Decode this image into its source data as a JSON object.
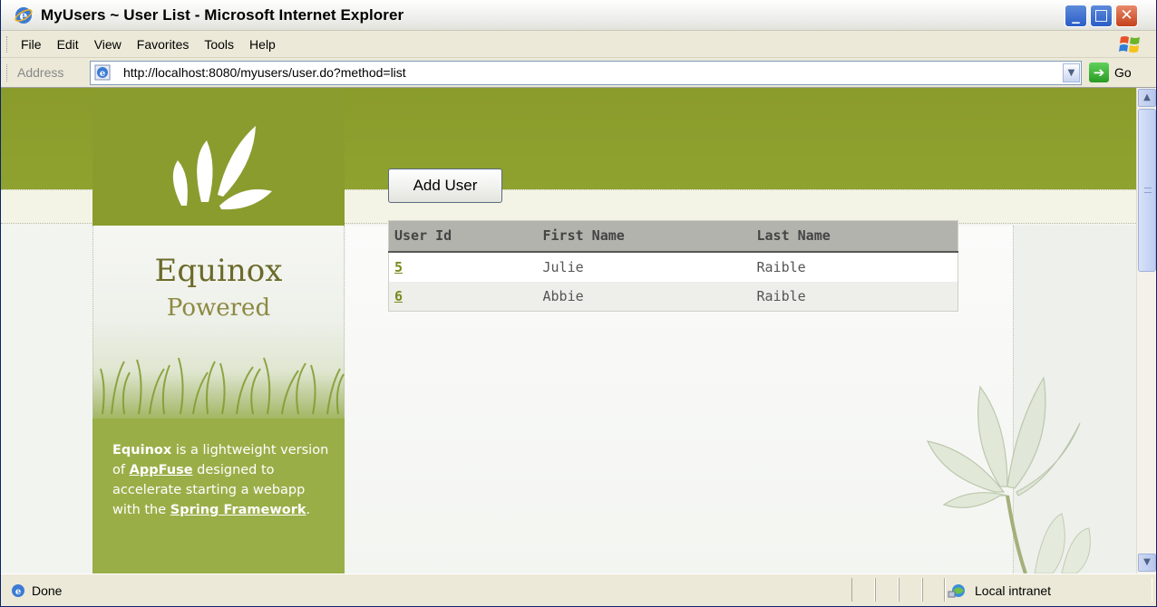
{
  "window": {
    "title": "MyUsers ~ User List - Microsoft Internet Explorer",
    "min_glyph": "_",
    "max_glyph": "□",
    "close_glyph": "✕"
  },
  "menu": {
    "items": [
      "File",
      "Edit",
      "View",
      "Favorites",
      "Tools",
      "Help"
    ]
  },
  "address": {
    "label": "Address",
    "url": "http://localhost:8080/myusers/user.do?method=list",
    "go_label": "Go"
  },
  "page": {
    "brand_title": "Equinox",
    "brand_subtitle": "Powered",
    "desc": {
      "word1": "Equinox",
      "text1": " is a lightweight version of ",
      "link1": "AppFuse",
      "text2": " designed to accelerate starting a webapp with the ",
      "link2": "Spring Framework",
      "text3": "."
    },
    "add_button": "Add User",
    "table": {
      "headers": [
        "User Id",
        "First Name",
        "Last Name"
      ],
      "rows": [
        {
          "id": "5",
          "first": "Julie",
          "last": "Raible"
        },
        {
          "id": "6",
          "first": "Abbie",
          "last": "Raible"
        }
      ]
    }
  },
  "status": {
    "text": "Done",
    "zone": "Local intranet"
  },
  "colors": {
    "band_green": "#8a9c2e",
    "link_green": "#7b8a1e",
    "desc_green": "#9aae48"
  }
}
